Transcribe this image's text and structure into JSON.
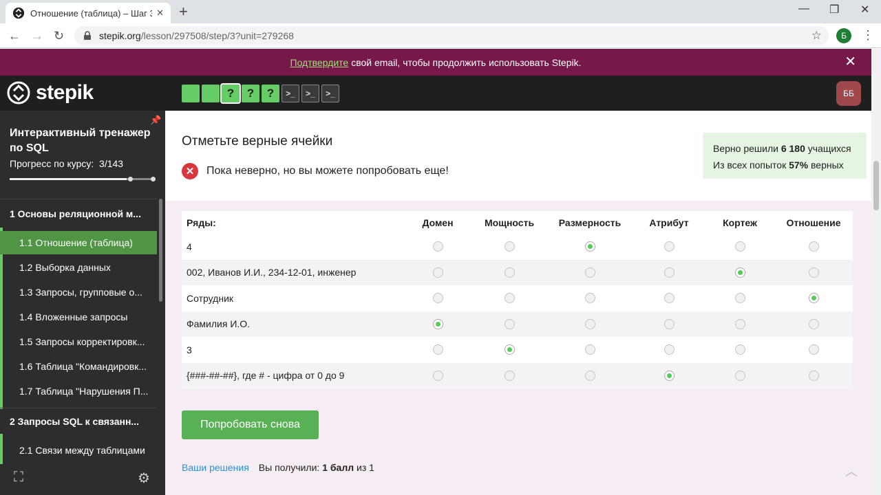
{
  "browser": {
    "tab_title": "Отношение (таблица) – Шаг 3 –",
    "url_host": "stepik.org",
    "url_path": "/lesson/297508/step/3?unit=279268",
    "profile_initial": "Б"
  },
  "banner": {
    "link_text": "Подтвердите",
    "text": "свой email, чтобы продолжить использовать Stepik."
  },
  "header": {
    "logo_text": "stepik",
    "steps": [
      {
        "type": "green",
        "label": ""
      },
      {
        "type": "green",
        "label": ""
      },
      {
        "type": "active",
        "label": "?"
      },
      {
        "type": "green",
        "label": "?"
      },
      {
        "type": "green",
        "label": "?"
      },
      {
        "type": "code",
        "label": ">_"
      },
      {
        "type": "code",
        "label": ">_"
      },
      {
        "type": "code",
        "label": ">_"
      }
    ],
    "user_initials": "ББ"
  },
  "sidebar": {
    "course_title": "Интерактивный тренажер по SQL",
    "progress_label": "Прогресс по курсу:",
    "progress_value": "3/143",
    "sections": [
      {
        "label": "1  Основы реляционной м..."
      },
      {
        "label": "2  Запросы SQL к связанн..."
      }
    ],
    "items": [
      {
        "label": "1.1  Отношение (таблица)"
      },
      {
        "label": "1.2  Выборка данных"
      },
      {
        "label": "1.3  Запросы, групповые о..."
      },
      {
        "label": "1.4  Вложенные запросы"
      },
      {
        "label": "1.5  Запросы корректировк..."
      },
      {
        "label": "1.6  Таблица \"Командировк..."
      },
      {
        "label": "1.7  Таблица \"Нарушения П..."
      },
      {
        "label": "2.1  Связи между таблицами"
      }
    ]
  },
  "content": {
    "step_title": "Отметьте верные ячейки",
    "stats": {
      "line1_prefix": "Верно решили",
      "line1_value": "6 180",
      "line1_suffix": "учащихся",
      "line2_prefix": "Из всех попыток",
      "line2_value": "57%",
      "line2_suffix": "верных"
    },
    "error_text": "Пока неверно, но вы можете попробовать еще!",
    "table": {
      "row_header": "Ряды:",
      "columns": [
        "Домен",
        "Мощность",
        "Размерность",
        "Атрибут",
        "Кортеж",
        "Отношение"
      ],
      "rows": [
        {
          "label": "4",
          "selected": 2
        },
        {
          "label": "002, Иванов И.И., 234-12-01, инженер",
          "selected": 4
        },
        {
          "label": "Сотрудник",
          "selected": 5
        },
        {
          "label": "Фамилия И.О.",
          "selected": 0
        },
        {
          "label": "3",
          "selected": 1
        },
        {
          "label": "{###-##-##}, где # - цифра от 0 до 9",
          "selected": 3
        }
      ]
    },
    "retry_label": "Попробовать снова",
    "solutions_link": "Ваши решения",
    "score_prefix": "Вы получили:",
    "score_value": "1 балл",
    "score_suffix": "из 1"
  }
}
